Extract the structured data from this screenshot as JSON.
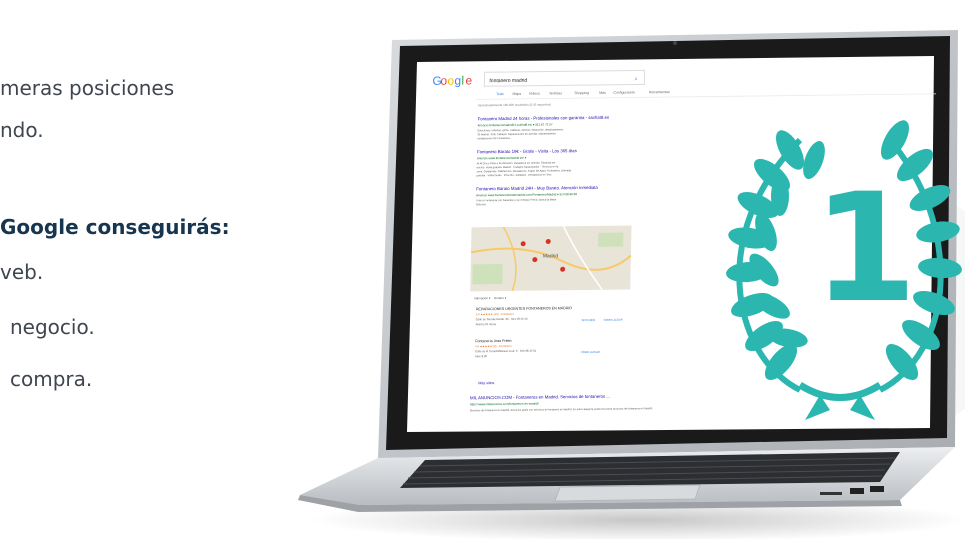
{
  "intro_lines": [
    "meras posiciones",
    "ndo."
  ],
  "heading": "Google conseguirás:",
  "bullets": [
    "veb.",
    "negocio.",
    "compra."
  ],
  "screen": {
    "search_query": "fontanero madrid",
    "tabs": [
      "Todo",
      "Maps",
      "Vídeos",
      "Noticias",
      "Shopping",
      "Más",
      "Configuración",
      "Herramientas"
    ],
    "result_stats": "Aproximadamente 195.000 resultados (0,45 segundos)",
    "ads": [
      {
        "title": "Fontanero Madrid 24 horas - Profesionales con garantía - ssirhat8.es",
        "url": "Anuncio  fontanerosmadrid24.ssirhat8.es/ ▾  911 67 73 57",
        "desc": "Soluciones, tuberías, grifos, calderas, averías, reparación, desplazamiento 30 Madrid. Todo Trabajos. Reparaciones En Averías. Mantenimiento. Instalaciones De Fontanería."
      },
      {
        "title": "Fontanero Barato 19€ - Gratis - Visita - Los 365 días",
        "url": "Anuncio  www.fontanerosmadrid.es/ ▾",
        "desc": "Al Al Cinco Pleto a la ubicación. Desatasca sin averías. Garantía por escrito. Visita gratuita. Madrid - Trabajos Garantizados - Técnicos en la zona. Categorías: Calefacción, Desatascos, Fugas De Agua, Fontanería. Llamada gratuita · Visita Gratis · 10% Dto. Jubilados · Desatascos en Tres"
      },
      {
        "title": "Fontanero Barato Madrid 24H - Muy Barato. Atención Inmediata",
        "url": "Anuncio  www.fontanerobaratomadrid.com/Fontanero/Madrid ▾  914 68 66 66",
        "desc": "Tota tu Fontanería con Garantía y con el Mejor Precio. Busca la Mejor Solución."
      }
    ],
    "map_labels": [
      "Madrid"
    ],
    "listing_filters": [
      "Valoración ▾",
      "Horario ▾"
    ],
    "listings": [
      {
        "name": "REPARACIONES URGENTES FONTANEROS EN MADRID",
        "rating": "5,0 ★★★★★ (40) · Fontanero",
        "address": "Calle de San Bernardo, 26 · 914 48 46 16",
        "status": "Abierto 24 horas",
        "actions": [
          "SITIO WEB",
          "CÓMO LLEGAR"
        ]
      },
      {
        "name": "Fontanería Jose Prieto",
        "rating": "4,6 ★★★★★ (9) · Fontanero",
        "address": "Calle de la Toronto/Manuel Leal, 5 · 916 98 10 01",
        "status": "Abre 8:00",
        "actions": [
          "CÓMO LLEGAR"
        ]
      }
    ],
    "more_places": "Más sitios",
    "organic": {
      "title": "MIL ANUNCIOS.COM - Fontaneros en Madrid. Servicios de fontaneros ...",
      "url": "https://www.milanuncios.com/fontaneros-en-madrid/",
      "desc": "Servicios de fontaneros en Madrid. Anuncios gratis con servicios de fontanero en Madrid. En esta categoría podrá encontrar anuncios de fontaneros en Madrid."
    }
  },
  "badge_number": "1",
  "colors": {
    "heading": "#17354f",
    "text": "#3f4650",
    "laurel": "#2bb7b0",
    "link": "#1a0dab",
    "url_green": "#006621"
  }
}
